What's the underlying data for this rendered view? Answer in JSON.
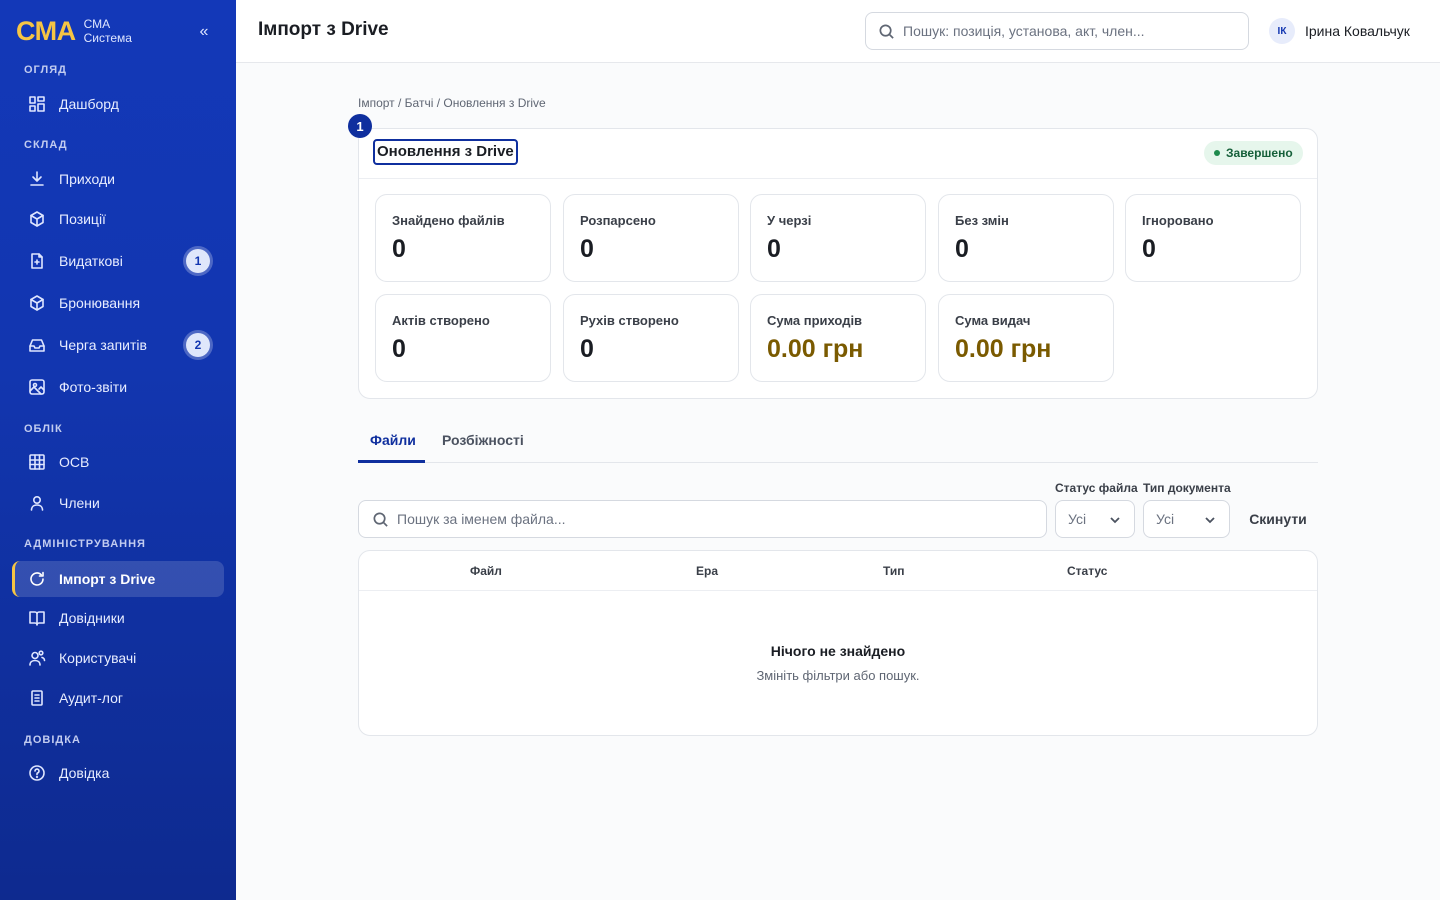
{
  "brand": {
    "logo": "СМА",
    "line1": "СМА",
    "line2": "Система",
    "collapse": "«"
  },
  "sidebar": {
    "sections": [
      {
        "title": "ОГЛЯД"
      },
      {
        "title": "СКЛАД"
      },
      {
        "title": "ОБЛІК"
      },
      {
        "title": "АДМІНІСТРУВАННЯ"
      },
      {
        "title": "ДОВІДКА"
      }
    ],
    "items": [
      {
        "label": "Дашборд",
        "icon": "dashboard-icon"
      },
      {
        "label": "Приходи",
        "icon": "download-icon"
      },
      {
        "label": "Позиції",
        "icon": "box-icon"
      },
      {
        "label": "Видаткові",
        "icon": "document-icon",
        "badge": "1"
      },
      {
        "label": "Бронювання",
        "icon": "box-icon"
      },
      {
        "label": "Черга запитів",
        "icon": "inbox-icon",
        "badge": "2"
      },
      {
        "label": "Фото-звіти",
        "icon": "image-icon"
      },
      {
        "label": "ОСВ",
        "icon": "table-icon"
      },
      {
        "label": "Члени",
        "icon": "user-icon"
      },
      {
        "label": "Імпорт з Drive",
        "icon": "refresh-icon",
        "active": true
      },
      {
        "label": "Довідники",
        "icon": "book-icon"
      },
      {
        "label": "Користувачі",
        "icon": "users-icon"
      },
      {
        "label": "Аудит-лог",
        "icon": "log-icon"
      },
      {
        "label": "Довідка",
        "icon": "help-icon"
      }
    ]
  },
  "header": {
    "title": "Імпорт з Drive",
    "search_placeholder": "Пошук: позиція, установа, акт, член...",
    "user_initials": "ІК",
    "user_name": "Ірина Ковальчук"
  },
  "breadcrumb": "Імпорт / Батчі / Оновлення з Drive",
  "step_marker": "1",
  "batch": {
    "title": "Оновлення з Drive",
    "status": "Завершено",
    "status_color": "#1e8a4c",
    "stats": [
      {
        "label": "Знайдено файлів",
        "value": "0"
      },
      {
        "label": "Розпарсено",
        "value": "0"
      },
      {
        "label": "У черзі",
        "value": "0"
      },
      {
        "label": "Без змін",
        "value": "0"
      },
      {
        "label": "Ігноровано",
        "value": "0"
      },
      {
        "label": "Актів створено",
        "value": "0"
      },
      {
        "label": "Рухів створено",
        "value": "0"
      },
      {
        "label": "Сума приходів",
        "value": "0.00 грн"
      },
      {
        "label": "Сума видач",
        "value": "0.00 грн"
      }
    ]
  },
  "tabs": [
    {
      "label": "Файли",
      "active": true
    },
    {
      "label": "Розбіжності",
      "active": false
    }
  ],
  "filters": {
    "search_placeholder": "Пошук за іменем файла...",
    "file_status_label": "Статус файла",
    "file_status_value": "Усі",
    "doc_type_label": "Тип документа",
    "doc_type_value": "Усі",
    "reset_label": "Скинути"
  },
  "table": {
    "columns": [
      "Файл",
      "Ера",
      "Тип",
      "Статус"
    ],
    "rows": [],
    "empty_title": "Нічого не знайдено",
    "empty_subtitle": "Змініть фільтри або пошук."
  },
  "colors": {
    "sidebar": "#1338b8",
    "accent": "#0f2f9e",
    "brand": "#f6c544",
    "money": "#7a5a00"
  }
}
